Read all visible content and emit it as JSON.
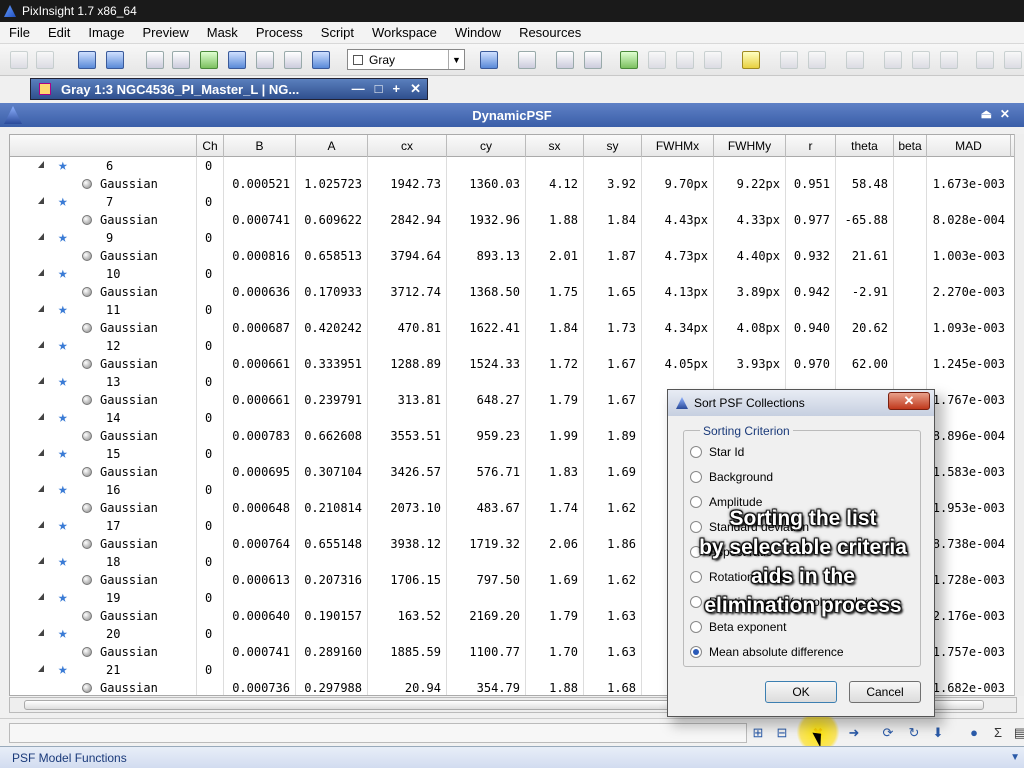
{
  "app": {
    "title": "PixInsight 1.7 x86_64"
  },
  "menu": [
    "File",
    "Edit",
    "Image",
    "Preview",
    "Mask",
    "Process",
    "Script",
    "Workspace",
    "Window",
    "Resources"
  ],
  "toolbar": {
    "color_mode": "Gray"
  },
  "image_tab": {
    "title": "Gray 1:3 NGC4536_PI_Master_L | NG...",
    "controls": [
      "—",
      "□",
      "+",
      "✕"
    ]
  },
  "panel": {
    "title": "DynamicPSF"
  },
  "table": {
    "columns": [
      "Ch",
      "B",
      "A",
      "cx",
      "cy",
      "sx",
      "sy",
      "FWHMx",
      "FWHMy",
      "r",
      "theta",
      "beta",
      "MAD"
    ],
    "rows": [
      {
        "id": "6",
        "ch": "0",
        "fn": "Gaussian",
        "B": "0.000521",
        "A": "1.025723",
        "cx": "1942.73",
        "cy": "1360.03",
        "sx": "4.12",
        "sy": "3.92",
        "FWHMx": "9.70px",
        "FWHMy": "9.22px",
        "r": "0.951",
        "theta": "58.48",
        "MAD": "1.673e-003"
      },
      {
        "id": "7",
        "ch": "0",
        "fn": "Gaussian",
        "B": "0.000741",
        "A": "0.609622",
        "cx": "2842.94",
        "cy": "1932.96",
        "sx": "1.88",
        "sy": "1.84",
        "FWHMx": "4.43px",
        "FWHMy": "4.33px",
        "r": "0.977",
        "theta": "-65.88",
        "MAD": "8.028e-004"
      },
      {
        "id": "9",
        "ch": "0",
        "fn": "Gaussian",
        "B": "0.000816",
        "A": "0.658513",
        "cx": "3794.64",
        "cy": "893.13",
        "sx": "2.01",
        "sy": "1.87",
        "FWHMx": "4.73px",
        "FWHMy": "4.40px",
        "r": "0.932",
        "theta": "21.61",
        "MAD": "1.003e-003"
      },
      {
        "id": "10",
        "ch": "0",
        "fn": "Gaussian",
        "B": "0.000636",
        "A": "0.170933",
        "cx": "3712.74",
        "cy": "1368.50",
        "sx": "1.75",
        "sy": "1.65",
        "FWHMx": "4.13px",
        "FWHMy": "3.89px",
        "r": "0.942",
        "theta": "-2.91",
        "MAD": "2.270e-003"
      },
      {
        "id": "11",
        "ch": "0",
        "fn": "Gaussian",
        "B": "0.000687",
        "A": "0.420242",
        "cx": "470.81",
        "cy": "1622.41",
        "sx": "1.84",
        "sy": "1.73",
        "FWHMx": "4.34px",
        "FWHMy": "4.08px",
        "r": "0.940",
        "theta": "20.62",
        "MAD": "1.093e-003"
      },
      {
        "id": "12",
        "ch": "0",
        "fn": "Gaussian",
        "B": "0.000661",
        "A": "0.333951",
        "cx": "1288.89",
        "cy": "1524.33",
        "sx": "1.72",
        "sy": "1.67",
        "FWHMx": "4.05px",
        "FWHMy": "3.93px",
        "r": "0.970",
        "theta": "62.00",
        "MAD": "1.245e-003"
      },
      {
        "id": "13",
        "ch": "0",
        "fn": "Gaussian",
        "B": "0.000661",
        "A": "0.239791",
        "cx": "313.81",
        "cy": "648.27",
        "sx": "1.79",
        "sy": "1.67",
        "MAD": "1.767e-003"
      },
      {
        "id": "14",
        "ch": "0",
        "fn": "Gaussian",
        "B": "0.000783",
        "A": "0.662608",
        "cx": "3553.51",
        "cy": "959.23",
        "sx": "1.99",
        "sy": "1.89",
        "MAD": "8.896e-004"
      },
      {
        "id": "15",
        "ch": "0",
        "fn": "Gaussian",
        "B": "0.000695",
        "A": "0.307104",
        "cx": "3426.57",
        "cy": "576.71",
        "sx": "1.83",
        "sy": "1.69",
        "MAD": "1.583e-003"
      },
      {
        "id": "16",
        "ch": "0",
        "fn": "Gaussian",
        "B": "0.000648",
        "A": "0.210814",
        "cx": "2073.10",
        "cy": "483.67",
        "sx": "1.74",
        "sy": "1.62",
        "MAD": "1.953e-003"
      },
      {
        "id": "17",
        "ch": "0",
        "fn": "Gaussian",
        "B": "0.000764",
        "A": "0.655148",
        "cx": "3938.12",
        "cy": "1719.32",
        "sx": "2.06",
        "sy": "1.86",
        "MAD": "8.738e-004"
      },
      {
        "id": "18",
        "ch": "0",
        "fn": "Gaussian",
        "B": "0.000613",
        "A": "0.207316",
        "cx": "1706.15",
        "cy": "797.50",
        "sx": "1.69",
        "sy": "1.62",
        "MAD": "1.728e-003"
      },
      {
        "id": "19",
        "ch": "0",
        "fn": "Gaussian",
        "B": "0.000640",
        "A": "0.190157",
        "cx": "163.52",
        "cy": "2169.20",
        "sx": "1.79",
        "sy": "1.63",
        "MAD": "2.176e-003"
      },
      {
        "id": "20",
        "ch": "0",
        "fn": "Gaussian",
        "B": "0.000741",
        "A": "0.289160",
        "cx": "1885.59",
        "cy": "1100.77",
        "sx": "1.70",
        "sy": "1.63",
        "MAD": "1.757e-003"
      },
      {
        "id": "21",
        "ch": "0",
        "fn": "Gaussian",
        "B": "0.000736",
        "A": "0.297988",
        "cx": "20.94",
        "cy": "354.79",
        "sx": "1.88",
        "sy": "1.68",
        "MAD": "1.682e-003"
      }
    ]
  },
  "status_bar": {
    "label": "PSF Model Functions"
  },
  "dialog": {
    "title": "Sort PSF Collections",
    "close_label": "✕",
    "group_label": "Sorting Criterion",
    "options": [
      {
        "label": "Star Id",
        "selected": false
      },
      {
        "label": "Background",
        "selected": false
      },
      {
        "label": "Amplitude",
        "selected": false
      },
      {
        "label": "Standard deviation",
        "selected": false
      },
      {
        "label": "Aspect ratio",
        "selected": false
      },
      {
        "label": "Rotation angle",
        "selected": false
      },
      {
        "label": "Rotation angle (absolute value)",
        "selected": false
      },
      {
        "label": "Beta exponent",
        "selected": false
      },
      {
        "label": "Mean absolute difference",
        "selected": true
      }
    ],
    "ok_label": "OK",
    "cancel_label": "Cancel"
  },
  "caption": {
    "lines": [
      "Sorting the list",
      "by selectable criteria",
      "aids in the",
      "elimination process"
    ]
  }
}
